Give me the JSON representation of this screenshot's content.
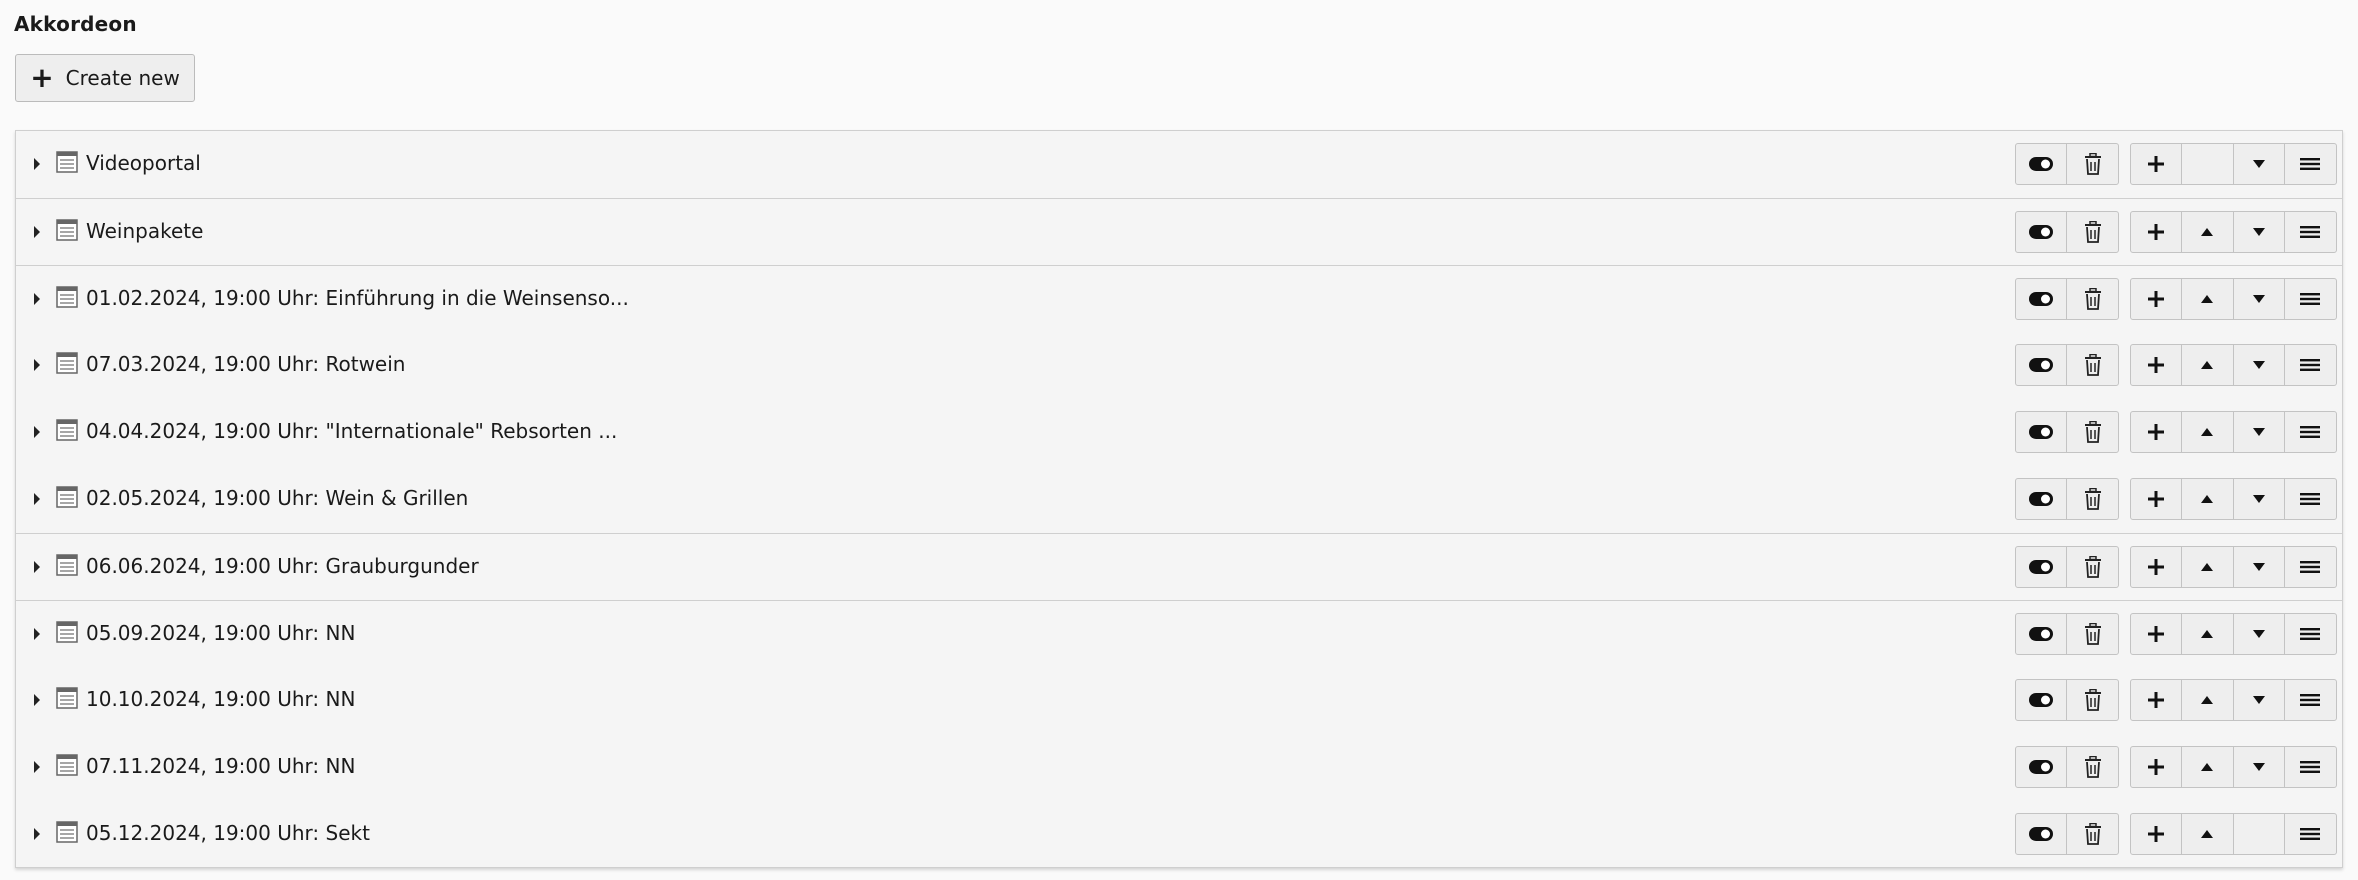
{
  "section": {
    "title": "Akkordeon",
    "create_label": "Create new"
  },
  "rows": [
    {
      "title": "Videoportal",
      "can_move_up": false,
      "can_move_down": true
    },
    {
      "title": "Weinpakete",
      "can_move_up": true,
      "can_move_down": true
    },
    {
      "title": "01.02.2024, 19:00 Uhr: Einführung in die Weinsenso...",
      "can_move_up": true,
      "can_move_down": true
    },
    {
      "title": "07.03.2024, 19:00 Uhr: Rotwein",
      "can_move_up": true,
      "can_move_down": true
    },
    {
      "title": "04.04.2024, 19:00 Uhr: \"Internationale\" Rebsorten ...",
      "can_move_up": true,
      "can_move_down": true
    },
    {
      "title": "02.05.2024, 19:00 Uhr: Wein & Grillen",
      "can_move_up": true,
      "can_move_down": true
    },
    {
      "title": "06.06.2024, 19:00 Uhr: Grauburgunder",
      "can_move_up": true,
      "can_move_down": true
    },
    {
      "title": "05.09.2024, 19:00 Uhr: NN",
      "can_move_up": true,
      "can_move_down": true
    },
    {
      "title": "10.10.2024, 19:00 Uhr: NN",
      "can_move_up": true,
      "can_move_down": true
    },
    {
      "title": "07.11.2024, 19:00 Uhr: NN",
      "can_move_up": true,
      "can_move_down": true
    },
    {
      "title": "05.12.2024, 19:00 Uhr: Sekt",
      "can_move_up": true,
      "can_move_down": false
    }
  ],
  "icons": {
    "expand": "caret-right-icon",
    "record": "document-icon",
    "toggle": "toggle-visibility-icon",
    "delete": "trash-icon",
    "add": "plus-icon",
    "up": "caret-up-icon",
    "down": "caret-down-icon",
    "drag": "drag-handle-icon"
  }
}
